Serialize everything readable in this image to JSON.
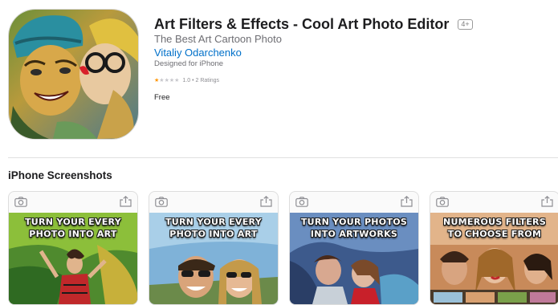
{
  "app": {
    "title": "Art Filters & Effects - Cool Art Photo Editor",
    "age_rating": "4+",
    "subtitle": "The Best Art Cartoon Photo",
    "developer": "Vitaliy Odarchenko",
    "designed_for": "Designed for iPhone",
    "rating_value": 1.0,
    "rating_text": "1.0 • 2 Ratings",
    "price": "Free",
    "icon": "app-icon-artistic-selfie"
  },
  "screenshots_section": {
    "title": "iPhone Screenshots",
    "items": [
      {
        "caption": "TURN YOUR EVERY PHOTO INTO ART"
      },
      {
        "caption": "TURN YOUR EVERY PHOTO INTO ART"
      },
      {
        "caption": "TURN YOUR PHOTOS INTO ARTWORKS"
      },
      {
        "caption": "NUMEROUS FILTERS TO CHOOSE FROM"
      }
    ]
  },
  "icons": {
    "camera": "camera-icon",
    "share": "share-icon",
    "star": "star-icon"
  },
  "colors": {
    "link": "#0070c9",
    "star": "#ff9500",
    "title": "#1d1d1f",
    "secondary": "#6e6e73"
  }
}
